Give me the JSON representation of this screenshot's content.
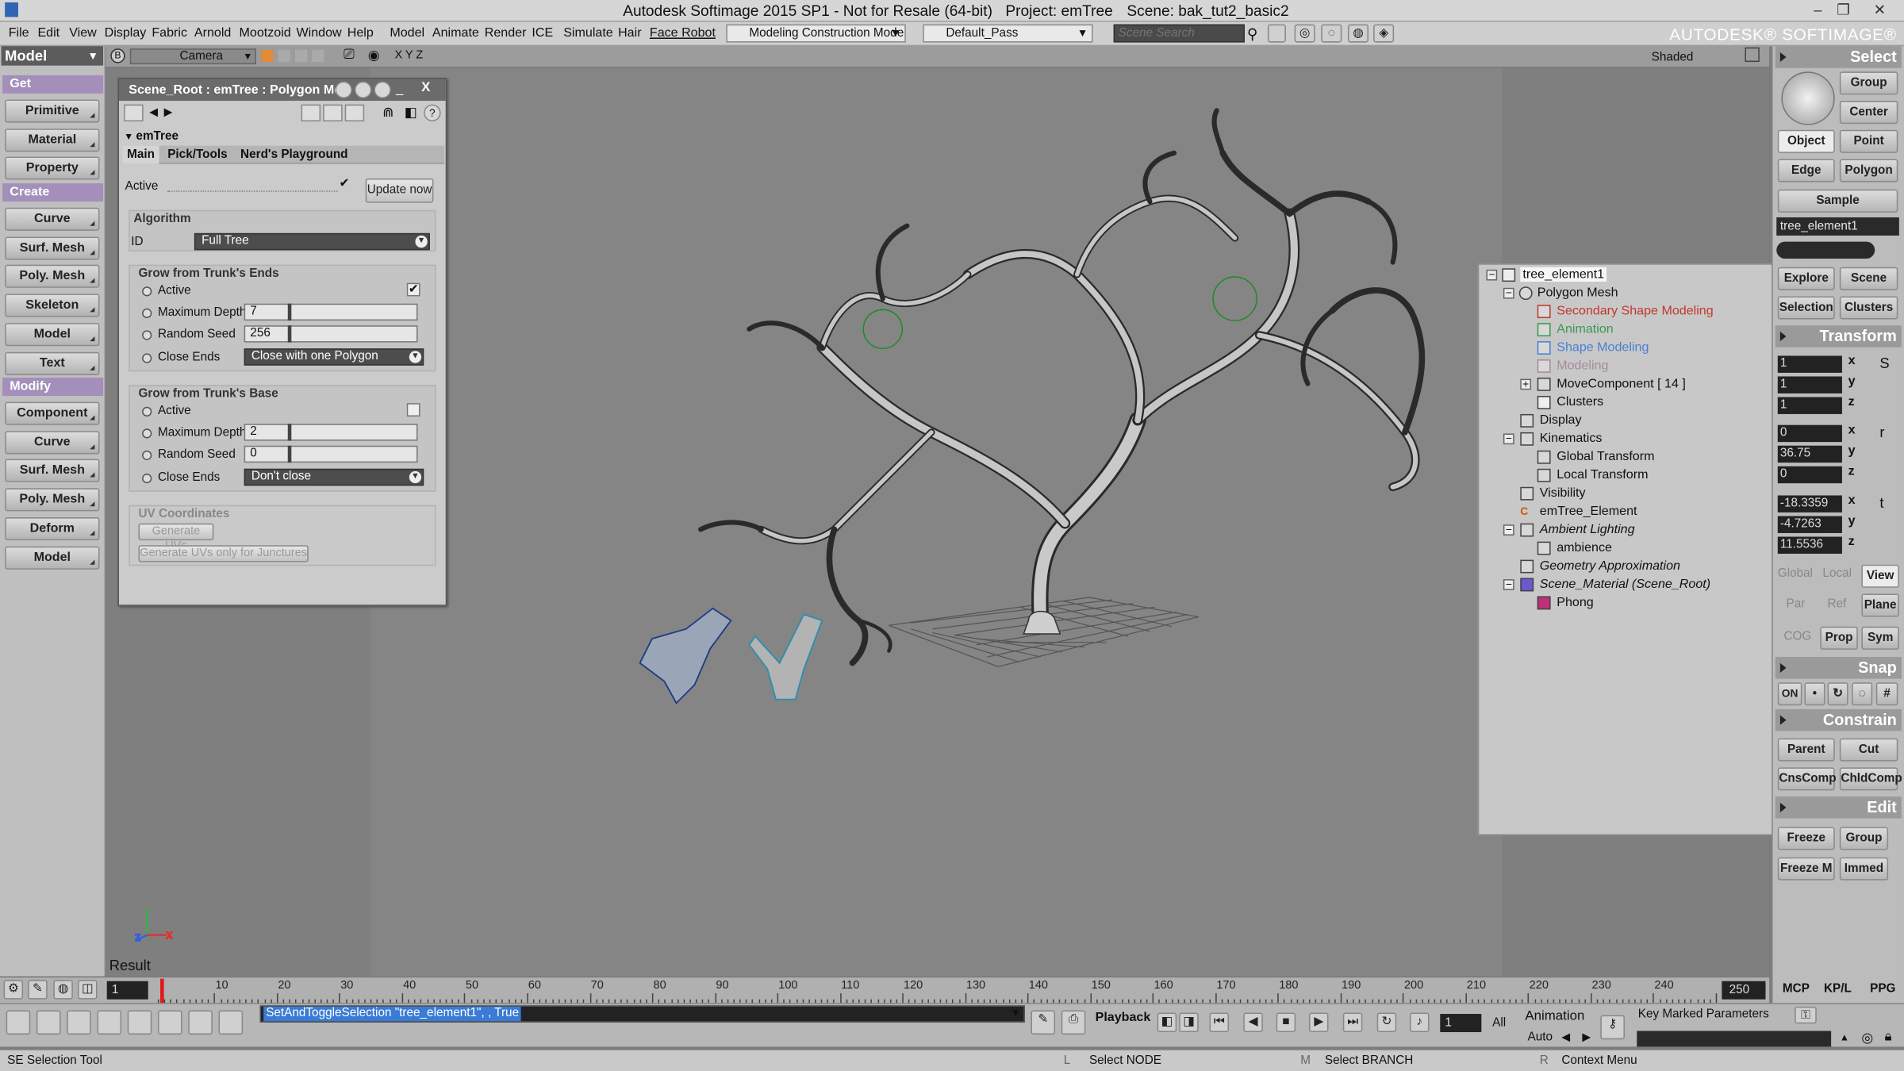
{
  "title": {
    "app_title": "Autodesk Softimage 2015 SP1  - Not for Resale (64-bit)",
    "project": "Project: emTree",
    "scene": "Scene: bak_tut2_basic2",
    "brand": "AUTODESK® SOFTIMAGE®",
    "window_buttons": [
      "–",
      "❐",
      "✕"
    ]
  },
  "menu": {
    "items": [
      "File",
      "Edit",
      "View",
      "Display",
      "Fabric",
      "Arnold",
      "Mootzoid",
      "Window",
      "Help",
      "Model",
      "Animate",
      "Render",
      "ICE",
      "Simulate",
      "Hair",
      "Face Robot"
    ],
    "construction_mode": "Modeling Construction Mode",
    "pass": "Default_Pass",
    "scene_search_placeholder": "Scene Search"
  },
  "left_toolbar": {
    "module": "Model",
    "get_header": "Get",
    "get_buttons": [
      "Primitive",
      "Material",
      "Property"
    ],
    "create_header": "Create",
    "create_buttons": [
      "Curve",
      "Surf. Mesh",
      "Poly. Mesh",
      "Skeleton",
      "Model",
      "Text"
    ],
    "modify_header": "Modify",
    "modify_buttons": [
      "Component",
      "Curve",
      "Surf. Mesh",
      "Poly. Mesh",
      "Deform",
      "Model"
    ]
  },
  "viewport": {
    "camera": "Camera",
    "axes_label": "X Y Z",
    "shading": "Shaded",
    "result_label": "Result",
    "axis_colors": {
      "x": "#e03030",
      "y": "#2fb54a",
      "z": "#3060e0"
    }
  },
  "property_panel": {
    "title": "Scene_Root : emTree : Polygon Me...",
    "close": "X",
    "section": "emTree",
    "tabs": [
      "Main",
      "Pick/Tools",
      "Nerd's Playground"
    ],
    "active_label": "Active",
    "active_checked": "✔",
    "update_now": "Update now",
    "algorithm_header": "Algorithm",
    "id_label": "ID",
    "id_value": "Full Tree",
    "trunk_ends": {
      "header": "Grow from Trunk's Ends",
      "active_label": "Active",
      "active_check": "✔",
      "max_depth_label": "Maximum Depth",
      "max_depth": "7",
      "max_depth_level": 0.25,
      "seed_label": "Random Seed",
      "seed": "256",
      "seed_level": 0.25,
      "close_label": "Close Ends",
      "close_value": "Close with one Polygon"
    },
    "trunk_base": {
      "header": "Grow from Trunk's Base",
      "active_label": "Active",
      "max_depth_label": "Maximum Depth",
      "max_depth": "2",
      "max_depth_level": 0.25,
      "seed_label": "Random Seed",
      "seed": "0",
      "seed_level": 0.25,
      "close_label": "Close Ends",
      "close_value": "Don't close"
    },
    "uv": {
      "header": "UV Coordinates",
      "gen_uvs": "Generate UVs",
      "gen_uvs_junctures": "Generate UVs only for Junctures"
    }
  },
  "explorer": {
    "rows": [
      {
        "text": "tree_element1",
        "color": "#111111"
      },
      {
        "text": "Polygon Mesh",
        "color": "#111111"
      },
      {
        "text": "Secondary Shape Modeling",
        "color": "#c0392b"
      },
      {
        "text": "Animation",
        "color": "#3a9a50"
      },
      {
        "text": "Shape Modeling",
        "color": "#4a7fd0"
      },
      {
        "text": "Modeling",
        "color": "#a88a9a"
      },
      {
        "text": "MoveComponent [ 14 ]",
        "color": "#111111"
      },
      {
        "text": "Clusters",
        "color": "#111111"
      },
      {
        "text": "Display",
        "color": "#111111"
      },
      {
        "text": "Kinematics",
        "color": "#111111"
      },
      {
        "text": "Global Transform",
        "color": "#111111"
      },
      {
        "text": "Local Transform",
        "color": "#111111"
      },
      {
        "text": "Visibility",
        "color": "#111111"
      },
      {
        "text": "emTree_Element",
        "color": "#111111"
      },
      {
        "text": "Ambient Lighting",
        "color": "#111111"
      },
      {
        "text": "ambience",
        "color": "#111111"
      },
      {
        "text": "Geometry Approximation",
        "color": "#111111"
      },
      {
        "text": "Scene_Material (Scene_Root)",
        "color": "#111111"
      },
      {
        "text": "Phong",
        "color": "#111111"
      }
    ]
  },
  "right_panel": {
    "select_header": "Select",
    "group": "Group",
    "center": "Center",
    "object": "Object",
    "point": "Point",
    "edge": "Edge",
    "polygon": "Polygon",
    "sample": "Sample",
    "selection_name": "tree_element1",
    "explore": "Explore",
    "scene": "Scene",
    "selection": "Selection",
    "clusters": "Clusters",
    "transform_header": "Transform",
    "scale": [
      "1",
      "1",
      "1"
    ],
    "rotate": [
      "0",
      "36.75",
      "0"
    ],
    "translate": [
      "-18.3359",
      "-4.7263",
      "11.5536"
    ],
    "axes": [
      "x",
      "y",
      "z"
    ],
    "global": "Global",
    "local": "Local",
    "view": "View",
    "par": "Par",
    "ref": "Ref",
    "plane": "Plane",
    "cog": "COG",
    "prop": "Prop",
    "sym": "Sym",
    "snap_header": "Snap",
    "snap_on": "ON",
    "constrain_header": "Constrain",
    "parent": "Parent",
    "cut": "Cut",
    "cnscomp": "CnsComp",
    "chldcomp": "ChldComp",
    "edit_header": "Edit",
    "freeze": "Freeze",
    "edit_group": "Group",
    "freeze_m": "Freeze M",
    "immed": "Immed",
    "mcp": "MCP",
    "kplp": "KP/L",
    "ppg": "PPG"
  },
  "timeline": {
    "frame": "1",
    "end": "250",
    "ticks": [
      "10",
      "20",
      "30",
      "40",
      "50",
      "60",
      "70",
      "80",
      "90",
      "100",
      "110",
      "120",
      "130",
      "140",
      "150",
      "160",
      "170",
      "180",
      "190",
      "200",
      "210",
      "220",
      "230",
      "240"
    ]
  },
  "bottom": {
    "command": "SetAndToggleSelection \"tree_element1\", , True",
    "playback": "Playback",
    "frame_field": "1",
    "all": "All",
    "animation": "Animation",
    "auto": "Auto",
    "key_marked": "Key Marked Parameters"
  },
  "status": {
    "tool": "SE Selection Tool",
    "l_key": "L",
    "l_text": "Select NODE",
    "m_key": "M",
    "m_text": "Select BRANCH",
    "r_key": "R",
    "r_text": "Context Menu"
  }
}
